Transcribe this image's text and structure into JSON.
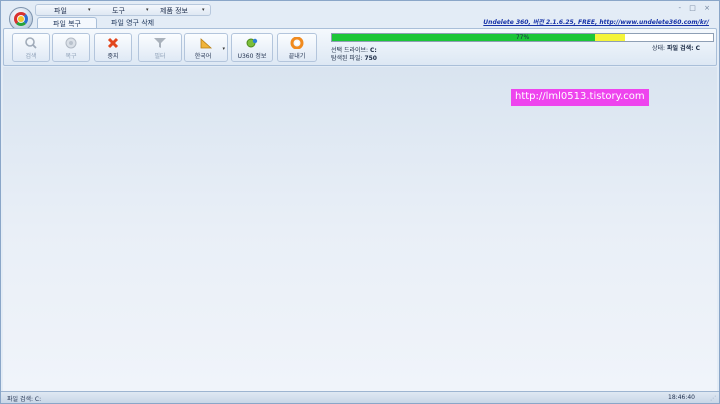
{
  "menu": {
    "items": [
      "파일",
      "도구",
      "제품 정보"
    ]
  },
  "window_controls": "- □ ×",
  "title_link": "Undelete 360, 버전 2.1.6.25, FREE, http://www.undelete360.com/kr/",
  "tabs": [
    "파일 복구",
    "파일 영구 삭제"
  ],
  "toolbar": {
    "buttons": [
      {
        "label": "검색",
        "icon": "magnifier-icon",
        "enabled": false
      },
      {
        "label": "복구",
        "icon": "recover-icon",
        "enabled": false
      },
      {
        "label": "중지",
        "icon": "stop-x-icon",
        "enabled": true
      },
      {
        "label": "필터",
        "icon": "funnel-icon",
        "enabled": false
      },
      {
        "label": "한국어",
        "icon": "language-icon",
        "enabled": true
      },
      {
        "label": "U360 정보",
        "icon": "info-gear-icon",
        "enabled": true
      },
      {
        "label": "끝내기",
        "icon": "exit-lifebuoy-icon",
        "enabled": true
      }
    ]
  },
  "progress": {
    "percent_label": "77%",
    "green_fraction": 0.69,
    "yellow_fraction": 0.08
  },
  "status_info": {
    "drive_label": "선택 드라이브:",
    "drive_value": "C:",
    "found_label": "탐색된 파일:",
    "found_value": "750",
    "state_label": "상태:",
    "state_value": "파일 검색: C"
  },
  "watermark": "http://lml0513.tistory.com",
  "statusbar": {
    "left": "파일 검색: C:",
    "time": "18:46:40"
  },
  "colors": {
    "progress_green": "#1cc637",
    "progress_yellow": "#f4f43a",
    "watermark_bg": "#ee44ee"
  }
}
